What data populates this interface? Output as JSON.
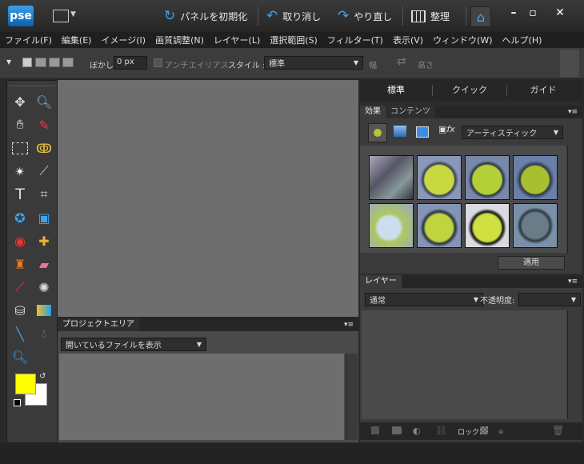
{
  "app": {
    "logo": "pse"
  },
  "toolbar": {
    "reset_panels": "パネルを初期化",
    "undo": "取り消し",
    "redo": "やり直し",
    "organize": "整理"
  },
  "menu": [
    "ファイル(F)",
    "編集(E)",
    "イメージ(I)",
    "画質調整(N)",
    "レイヤー(L)",
    "選択範囲(S)",
    "フィルター(T)",
    "表示(V)",
    "ウィンドウ(W)",
    "ヘルプ(H)"
  ],
  "options": {
    "feather_label": "ぼかし:",
    "feather_value": "0 px",
    "antialias_label": "アンチエイリアス",
    "style_label": "スタイル :",
    "style_value": "標準",
    "width_label": "幅",
    "height_label": "高さ"
  },
  "project": {
    "title": "プロジェクトエリア",
    "filter": "開いているファイルを表示"
  },
  "modes": [
    "標準",
    "クイック",
    "ガイド"
  ],
  "effects": {
    "tab1": "効果",
    "tab2": "コンテンツ",
    "category": "アーティスティック",
    "apply": "適用"
  },
  "layers": {
    "title": "レイヤー",
    "blend": "通常",
    "opacity_label": "不透明度:",
    "lock_label": "ロック:"
  },
  "colors": {
    "foreground": "#ffff00",
    "background": "#ffffff"
  }
}
